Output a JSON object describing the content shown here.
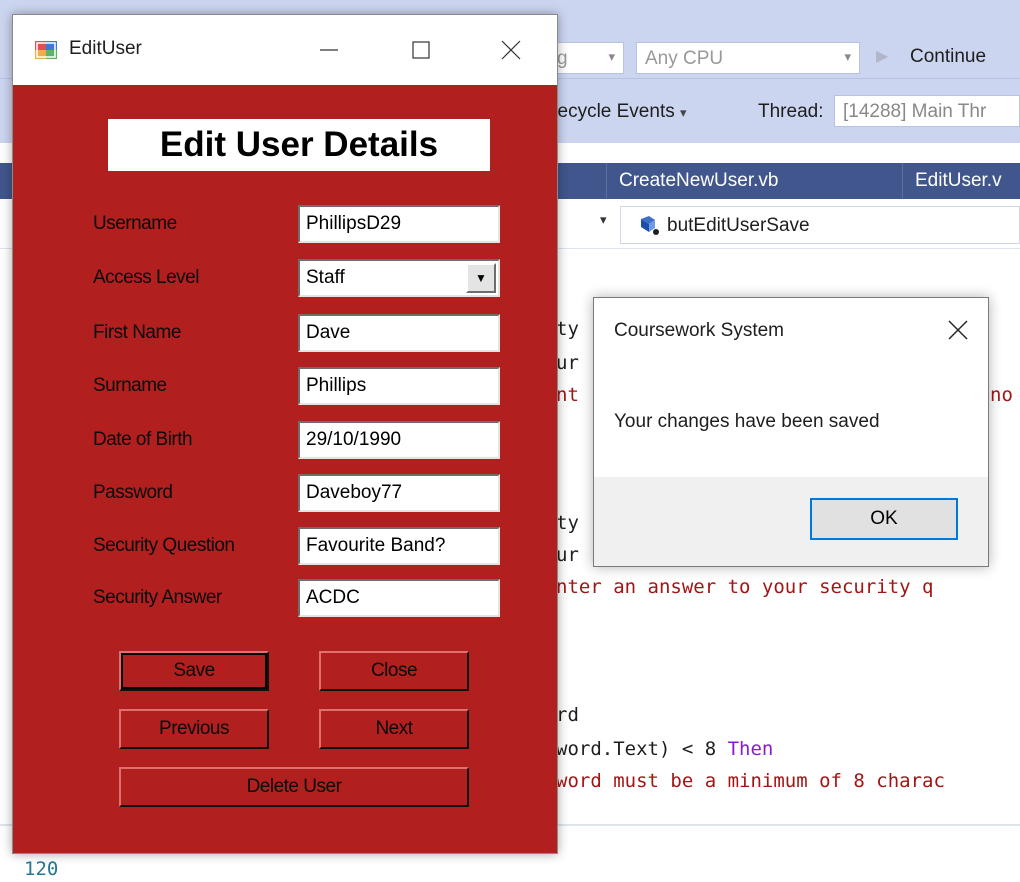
{
  "vs": {
    "config_partial": "g",
    "platform": "Any CPU",
    "continue_label": "Continue",
    "lifecycle_label": "ifecycle Events",
    "thread_label": "Thread:",
    "thread_value": "[14288] Main Thr",
    "tabs": [
      {
        "label": "CreateNewUser.vb"
      },
      {
        "label": "EditUser.v"
      }
    ],
    "member_combo": "butEditUserSave",
    "code_lines": [
      {
        "text": "ty",
        "color": "plain"
      },
      {
        "text": "ur",
        "color": "plain"
      },
      {
        "text": "nt",
        "color": "str"
      },
      {
        "text": "no",
        "color": "str"
      },
      {
        "text": "ty",
        "color": "plain"
      },
      {
        "text": "ur",
        "color": "plain"
      },
      {
        "text": "nter an answer to your security q",
        "color": "str"
      },
      {
        "text": "rd",
        "color": "plain"
      },
      {
        "text": "word.Text) < 8 ",
        "color": "plain"
      },
      {
        "text": "Then",
        "color": "kw"
      },
      {
        "text": "word must be a minimum of 8 charac",
        "color": "str"
      }
    ],
    "line_number": "120"
  },
  "edit_window": {
    "title": "EditUser",
    "heading": "Edit User Details",
    "fields": [
      {
        "label": "Username",
        "value": "PhillipsD29"
      },
      {
        "label": "Access Level",
        "value": "Staff"
      },
      {
        "label": "First Name",
        "value": "Dave"
      },
      {
        "label": "Surname",
        "value": "Phillips"
      },
      {
        "label": "Date of Birth",
        "value": "29/10/1990"
      },
      {
        "label": "Password",
        "value": "Daveboy77"
      },
      {
        "label": "Security Question",
        "value": "Favourite Band?"
      },
      {
        "label": "Security Answer",
        "value": "ACDC"
      }
    ],
    "buttons": {
      "save": "Save",
      "close": "Close",
      "previous": "Previous",
      "next": "Next",
      "delete": "Delete User"
    },
    "colors": {
      "form_background": "#b11f1e"
    }
  },
  "messagebox": {
    "title": "Coursework System",
    "message": "Your changes have been saved",
    "ok": "OK"
  }
}
